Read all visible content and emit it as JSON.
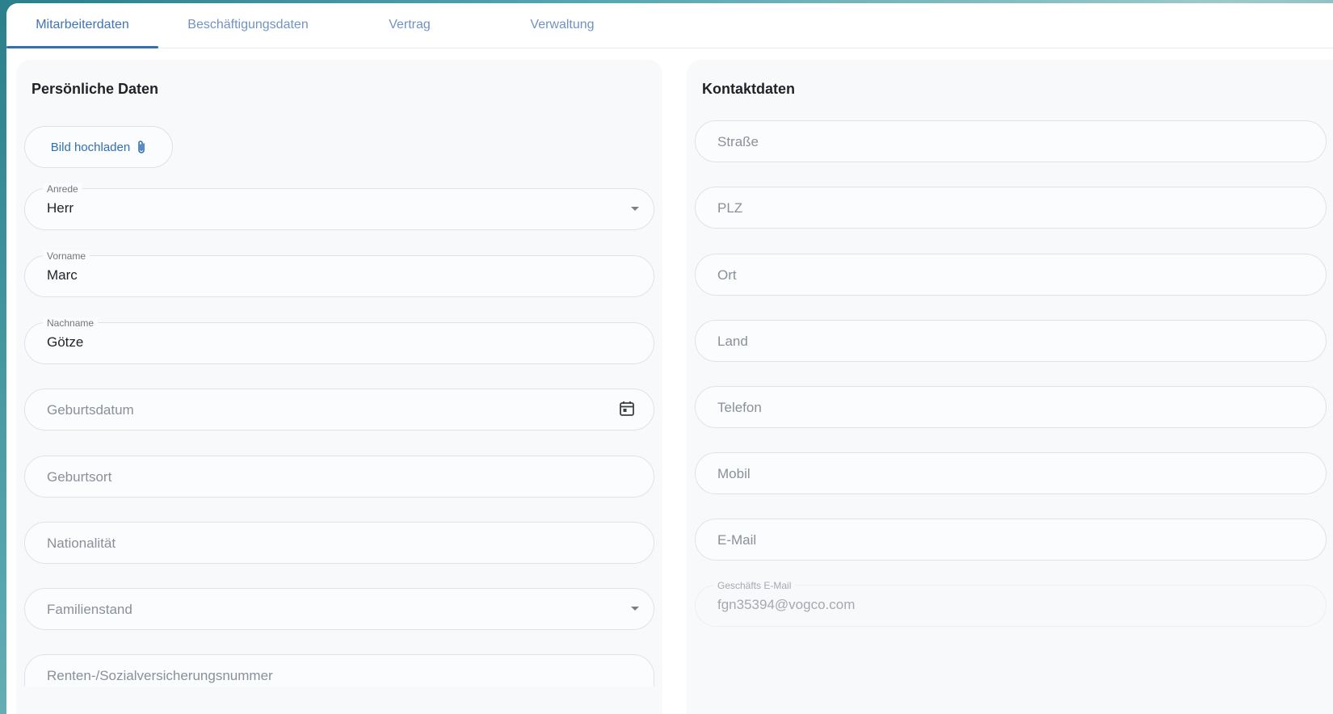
{
  "tabs": [
    {
      "label": "Mitarbeiterdaten",
      "active": true
    },
    {
      "label": "Beschäftigungsdaten",
      "active": false
    },
    {
      "label": "Vertrag",
      "active": false
    },
    {
      "label": "Verwaltung",
      "active": false
    }
  ],
  "personal": {
    "title": "Persönliche Daten",
    "upload_label": "Bild hochladen",
    "anrede": {
      "label": "Anrede",
      "value": "Herr"
    },
    "vorname": {
      "label": "Vorname",
      "value": "Marc"
    },
    "nachname": {
      "label": "Nachname",
      "value": "Götze"
    },
    "geburtsdatum_placeholder": "Geburtsdatum",
    "geburtsort_placeholder": "Geburtsort",
    "nationalitaet_placeholder": "Nationalität",
    "familienstand_placeholder": "Familienstand",
    "sozialversicherung_placeholder": "Renten-/Sozialversicherungsnummer"
  },
  "contact": {
    "title": "Kontaktdaten",
    "strasse_placeholder": "Straße",
    "plz_placeholder": "PLZ",
    "ort_placeholder": "Ort",
    "land_placeholder": "Land",
    "telefon_placeholder": "Telefon",
    "mobil_placeholder": "Mobil",
    "email_placeholder": "E-Mail",
    "business_email": {
      "label": "Geschäfts E-Mail",
      "value": "fgn35394@vogco.com"
    }
  },
  "colors": {
    "accent": "#2f6fb6",
    "panel_bg": "#f8f9fb"
  }
}
